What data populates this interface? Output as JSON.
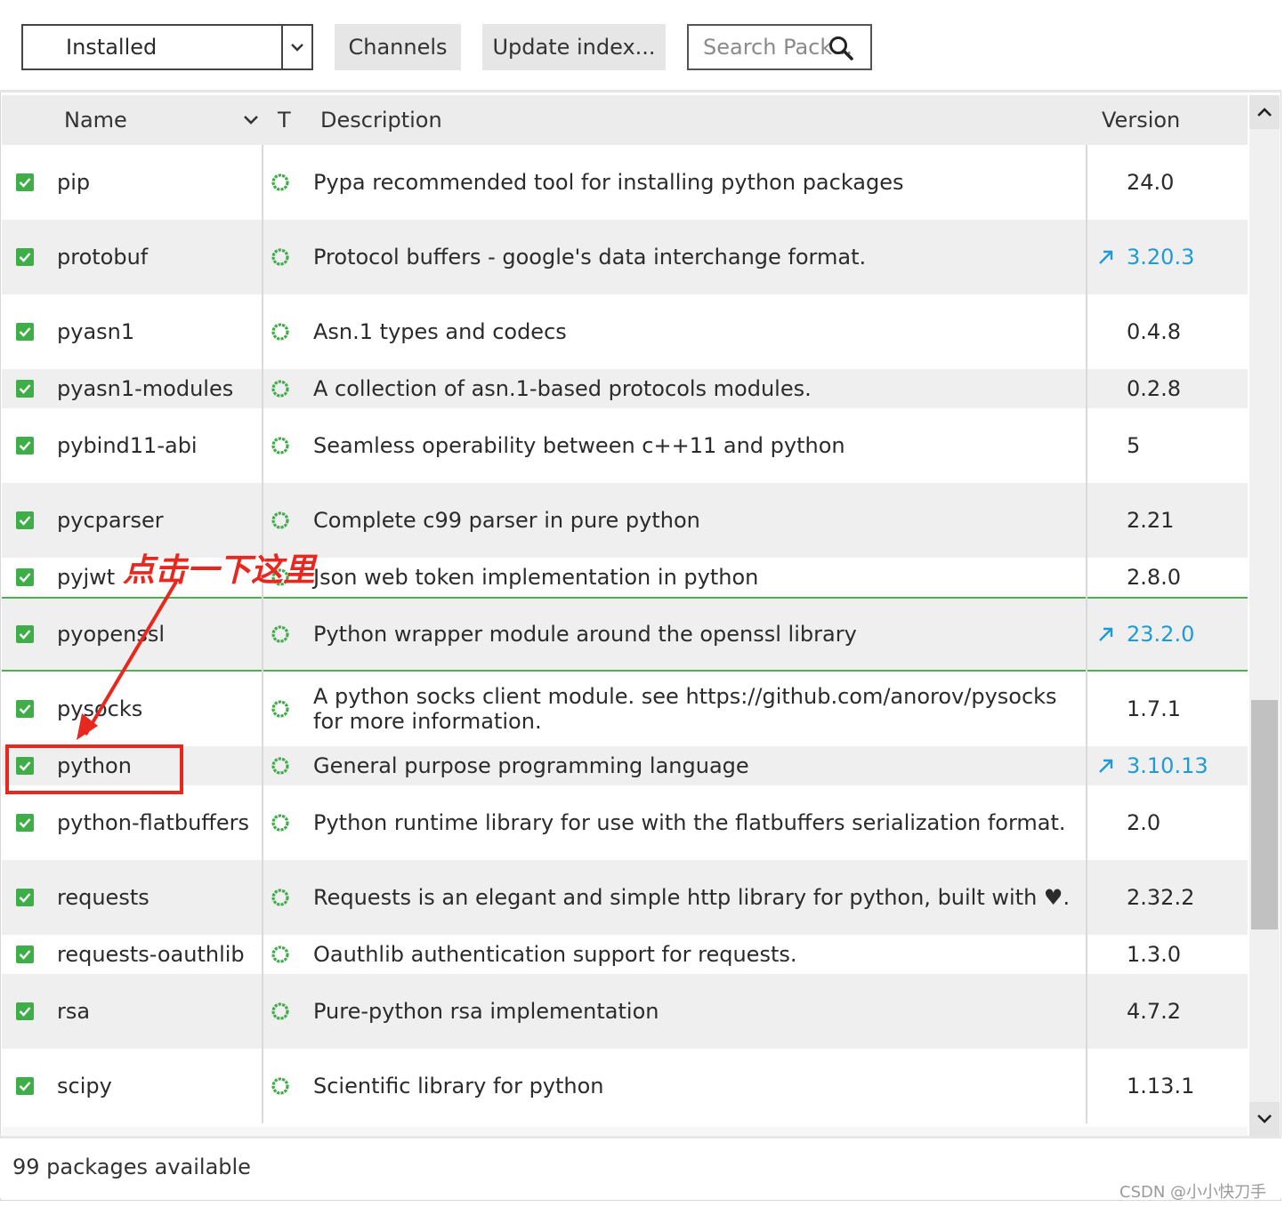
{
  "toolbar": {
    "filter_selected": "Installed",
    "channels_label": "Channels",
    "update_label": "Update index...",
    "search_placeholder": "Search Pack..."
  },
  "columns": {
    "name": "Name",
    "type": "T",
    "description": "Description",
    "version": "Version"
  },
  "packages": [
    {
      "name": "pip",
      "description": "Pypa recommended tool for installing python packages",
      "version": "24.0",
      "update": false
    },
    {
      "name": "protobuf",
      "description": "Protocol buffers - google's data interchange format.",
      "version": "3.20.3",
      "update": true
    },
    {
      "name": "pyasn1",
      "description": "Asn.1 types and codecs",
      "version": "0.4.8",
      "update": false
    },
    {
      "name": "pyasn1-modules",
      "description": "A collection of asn.1-based protocols modules.",
      "version": "0.2.8",
      "update": false
    },
    {
      "name": "pybind11-abi",
      "description": "Seamless operability between c++11 and python",
      "version": "5",
      "update": false
    },
    {
      "name": "pycparser",
      "description": "Complete c99 parser in pure python",
      "version": "2.21",
      "update": false
    },
    {
      "name": "pyjwt",
      "description": "Json web token implementation in python",
      "version": "2.8.0",
      "update": false
    },
    {
      "name": "pyopenssl",
      "description": "Python wrapper module around the openssl library",
      "version": "23.2.0",
      "update": true
    },
    {
      "name": "pysocks",
      "description": "A python socks client module. see https://github.com/anorov/pysocks for more information.",
      "version": "1.7.1",
      "update": false
    },
    {
      "name": "python",
      "description": "General purpose programming language",
      "version": "3.10.13",
      "update": true
    },
    {
      "name": "python-flatbuffers",
      "description": "Python runtime library for use with the flatbuffers serialization format.",
      "version": "2.0",
      "update": false
    },
    {
      "name": "requests",
      "description": "Requests is an elegant and simple http library for python, built with ♥.",
      "version": "2.32.2",
      "update": false
    },
    {
      "name": "requests-oauthlib",
      "description": "Oauthlib authentication support for requests.",
      "version": "1.3.0",
      "update": false
    },
    {
      "name": "rsa",
      "description": "Pure-python rsa implementation",
      "version": "4.7.2",
      "update": false
    },
    {
      "name": "scipy",
      "description": "Scientific library for python",
      "version": "1.13.1",
      "update": false
    }
  ],
  "selected_row": "pyopenssl",
  "footer": {
    "count_text": "99 packages available"
  },
  "annotation": {
    "text": "点击一下这里",
    "color": "#e8271f"
  },
  "watermark": "CSDN @小小快刀手",
  "colors": {
    "check_green": "#3fae49",
    "update_blue": "#1e9bd7",
    "selected_border": "#4caf50"
  }
}
